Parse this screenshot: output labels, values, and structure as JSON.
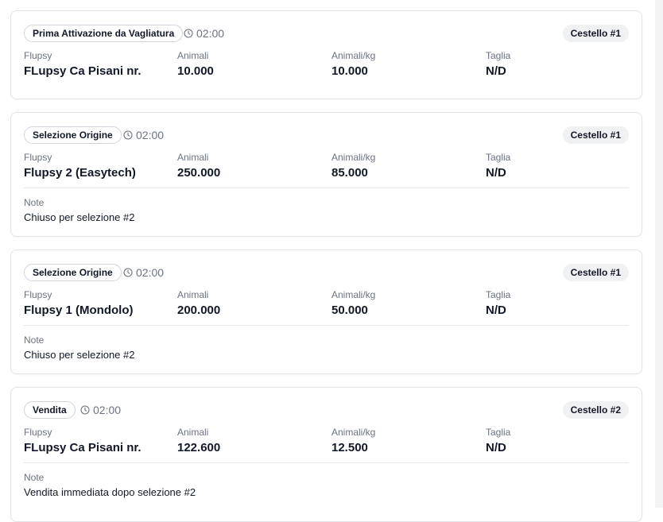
{
  "labels": {
    "flupsy": "Flupsy",
    "animals": "Animali",
    "animals_per_kg": "Animali/kg",
    "size": "Taglia",
    "note": "Note"
  },
  "operations": [
    {
      "type": "Prima Attivazione da Vagliatura",
      "time": "02:00",
      "basket": "Cestello #1",
      "flupsy": "FLupsy Ca Pisani nr.",
      "animals": "10.000",
      "animals_per_kg": "10.000",
      "size": "N/D",
      "note": ""
    },
    {
      "type": "Selezione Origine",
      "time": "02:00",
      "basket": "Cestello #1",
      "flupsy": "Flupsy 2 (Easytech)",
      "animals": "250.000",
      "animals_per_kg": "85.000",
      "size": "N/D",
      "note": "Chiuso per selezione #2"
    },
    {
      "type": "Selezione Origine",
      "time": "02:00",
      "basket": "Cestello #1",
      "flupsy": "Flupsy 1 (Mondolo)",
      "animals": "200.000",
      "animals_per_kg": "50.000",
      "size": "N/D",
      "note": "Chiuso per selezione #2"
    },
    {
      "type": "Vendita",
      "time": "02:00",
      "basket": "Cestello #2",
      "flupsy": "FLupsy Ca Pisani nr.",
      "animals": "122.600",
      "animals_per_kg": "12.500",
      "size": "N/D",
      "note": "Vendita immediata dopo selezione #2"
    }
  ]
}
